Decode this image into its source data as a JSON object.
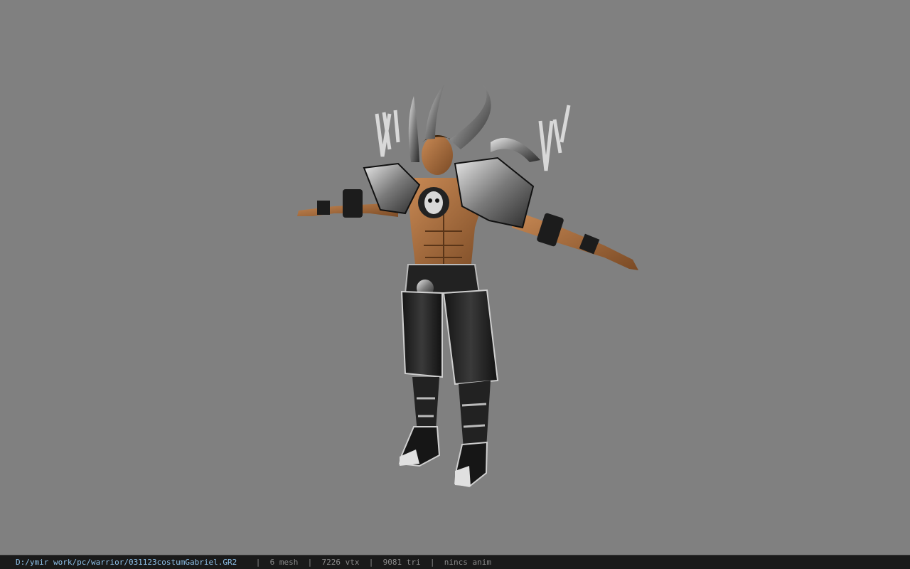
{
  "status": {
    "file_path": "D:/ymir work/pc/warrior/031123costumGabriel.GR2",
    "separator": "|",
    "mesh": "6 mesh",
    "vertices": "7226 vtx",
    "triangles": "9081 tri",
    "animation": "nincs anim"
  },
  "colors": {
    "viewport_background": "#808080",
    "status_background": "#1a1a1a",
    "path_text": "#8ec0e8",
    "stat_text": "#8a8a8a"
  },
  "model": {
    "icon": "warrior-character-model"
  }
}
